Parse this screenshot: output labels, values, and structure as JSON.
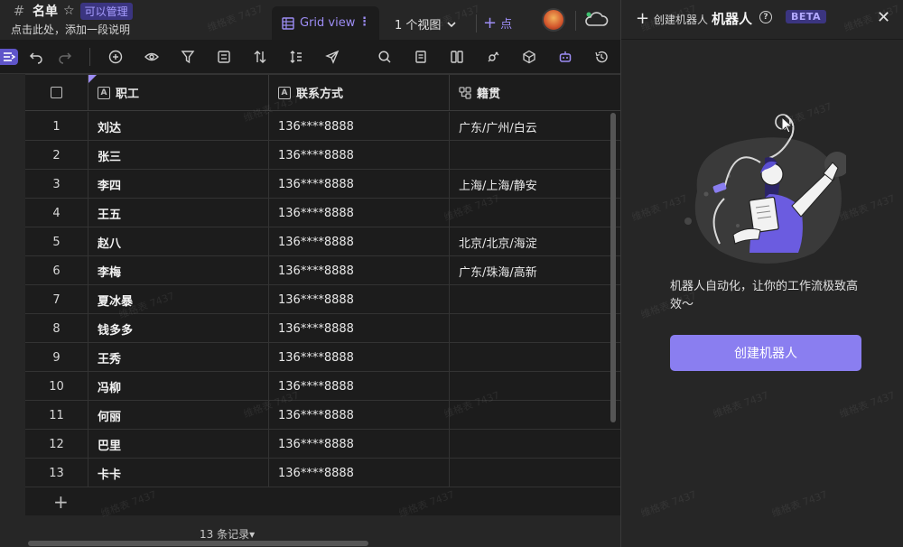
{
  "header": {
    "title": "名单",
    "permission_badge": "可以管理",
    "subtitle": "点击此处，添加一段说明"
  },
  "views": {
    "active_tab": "Grid view",
    "view_count_label": "1 个视图",
    "add_label": "点"
  },
  "table": {
    "columns": [
      {
        "label": "职工",
        "icon": "text-field-icon"
      },
      {
        "label": "联系方式",
        "icon": "text-field-icon"
      },
      {
        "label": "籍贯",
        "icon": "cascade-field-icon"
      }
    ],
    "rows": [
      {
        "num": "1",
        "name": "刘达",
        "phone": "136****8888",
        "origin": "广东/广州/白云"
      },
      {
        "num": "2",
        "name": "张三",
        "phone": "136****8888",
        "origin": ""
      },
      {
        "num": "3",
        "name": "李四",
        "phone": "136****8888",
        "origin": "上海/上海/静安"
      },
      {
        "num": "4",
        "name": "王五",
        "phone": "136****8888",
        "origin": ""
      },
      {
        "num": "5",
        "name": "赵八",
        "phone": "136****8888",
        "origin": "北京/北京/海淀"
      },
      {
        "num": "6",
        "name": "李梅",
        "phone": "136****8888",
        "origin": "广东/珠海/高新"
      },
      {
        "num": "7",
        "name": "夏冰暴",
        "phone": "136****8888",
        "origin": ""
      },
      {
        "num": "8",
        "name": "钱多多",
        "phone": "136****8888",
        "origin": ""
      },
      {
        "num": "9",
        "name": "王秀",
        "phone": "136****8888",
        "origin": ""
      },
      {
        "num": "10",
        "name": "冯柳",
        "phone": "136****8888",
        "origin": ""
      },
      {
        "num": "11",
        "name": "何丽",
        "phone": "136****8888",
        "origin": ""
      },
      {
        "num": "12",
        "name": "巴里",
        "phone": "136****8888",
        "origin": ""
      },
      {
        "num": "13",
        "name": "卡卡",
        "phone": "136****8888",
        "origin": ""
      }
    ],
    "record_count": "13 条记录▾"
  },
  "panel": {
    "header_small": "创建机器人",
    "header_big": "机器人",
    "beta_badge": "BETA",
    "description": "机器人自动化，让你的工作流极致高效～",
    "create_button": "创建机器人"
  },
  "watermark": "维格表 7437",
  "colors": {
    "accent": "#8a7ef0",
    "accent_text": "#9d8df5",
    "badge_bg": "#3b3580",
    "background": "#262626",
    "grid_bg": "#1c1c1c"
  }
}
